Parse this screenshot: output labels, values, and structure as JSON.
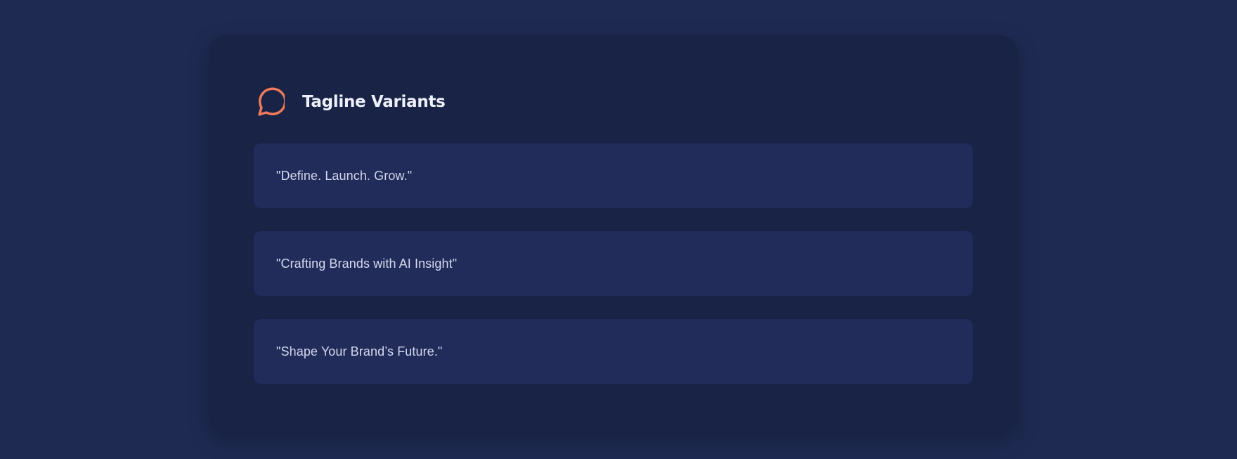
{
  "card": {
    "title": "Tagline Variants",
    "icon": "speech-bubble-icon",
    "accent_color": "#f07a5a"
  },
  "taglines": [
    {
      "text": "\"Define. Launch. Grow.\""
    },
    {
      "text": "\"Crafting Brands with AI Insight\""
    },
    {
      "text": "\"Shape Your Brand’s Future.\""
    }
  ]
}
